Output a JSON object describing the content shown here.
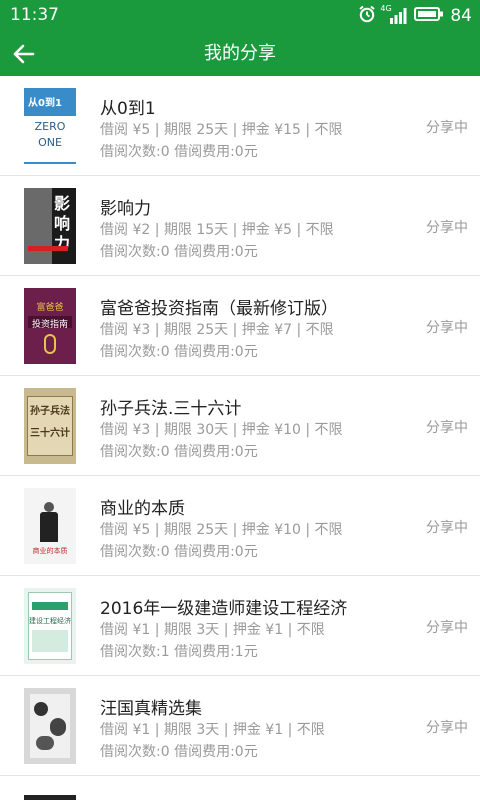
{
  "status_bar": {
    "time": "11:37",
    "network": "4G",
    "battery": "84",
    "icons": [
      "alarm-icon",
      "signal-icon",
      "battery-icon"
    ]
  },
  "app_bar": {
    "title": "我的分享",
    "back_icon": "arrow-left-icon"
  },
  "colors": {
    "primary": "#1a9a3c",
    "muted_text": "#9a9a9a",
    "title_text": "#222222",
    "divider": "#e4e4e4"
  },
  "books": [
    {
      "title": "从0到1",
      "meta": "借阅 ¥5 | 期限 25天 | 押金 ¥15 | 不限",
      "stats": "借阅次数:0 借阅费用:0元",
      "status": "分享中",
      "cover": {
        "bg": "#3a8cc9",
        "line1": "从0到1",
        "line2": "ZERO",
        "line3": "ONE"
      }
    },
    {
      "title": "影响力",
      "meta": "借阅 ¥2 | 期限 15天 | 押金 ¥5 | 不限",
      "stats": "借阅次数:0 借阅费用:0元",
      "status": "分享中",
      "cover": {
        "bg": "#1b1b1b",
        "line1": "影",
        "line2": "响",
        "line3": "力"
      }
    },
    {
      "title": "富爸爸投资指南（最新修订版）",
      "meta": "借阅 ¥3 | 期限 25天 | 押金 ¥7 | 不限",
      "stats": "借阅次数:0 借阅费用:0元",
      "status": "分享中",
      "cover": {
        "bg": "#6b1f4a",
        "line1": "富爸爸",
        "line2": "投资指南",
        "line3": ""
      }
    },
    {
      "title": "孙子兵法.三十六计",
      "meta": "借阅 ¥3 | 期限 30天 | 押金 ¥10 | 不限",
      "stats": "借阅次数:0 借阅费用:0元",
      "status": "分享中",
      "cover": {
        "bg": "#c9b98f",
        "line1": "孙子兵法",
        "line2": "三十六计",
        "line3": ""
      }
    },
    {
      "title": "商业的本质",
      "meta": "借阅 ¥5 | 期限 25天 | 押金 ¥10 | 不限",
      "stats": "借阅次数:0 借阅费用:0元",
      "status": "分享中",
      "cover": {
        "bg": "#f4f4f4",
        "line1": "商业的本质",
        "line2": "",
        "line3": ""
      }
    },
    {
      "title": "2016年一级建造师建设工程经济",
      "meta": "借阅 ¥1 | 期限 3天 | 押金 ¥1 | 不限",
      "stats": "借阅次数:1 借阅费用:1元",
      "status": "分享中",
      "cover": {
        "bg": "#e9f3ef",
        "line1": "建设工程经济",
        "line2": "",
        "line3": ""
      }
    },
    {
      "title": "汪国真精选集",
      "meta": "借阅 ¥1 | 期限 3天 | 押金 ¥1 | 不限",
      "stats": "借阅次数:0 借阅费用:0元",
      "status": "分享中",
      "cover": {
        "bg": "#d8d8d8",
        "line1": "",
        "line2": "",
        "line3": ""
      }
    }
  ]
}
